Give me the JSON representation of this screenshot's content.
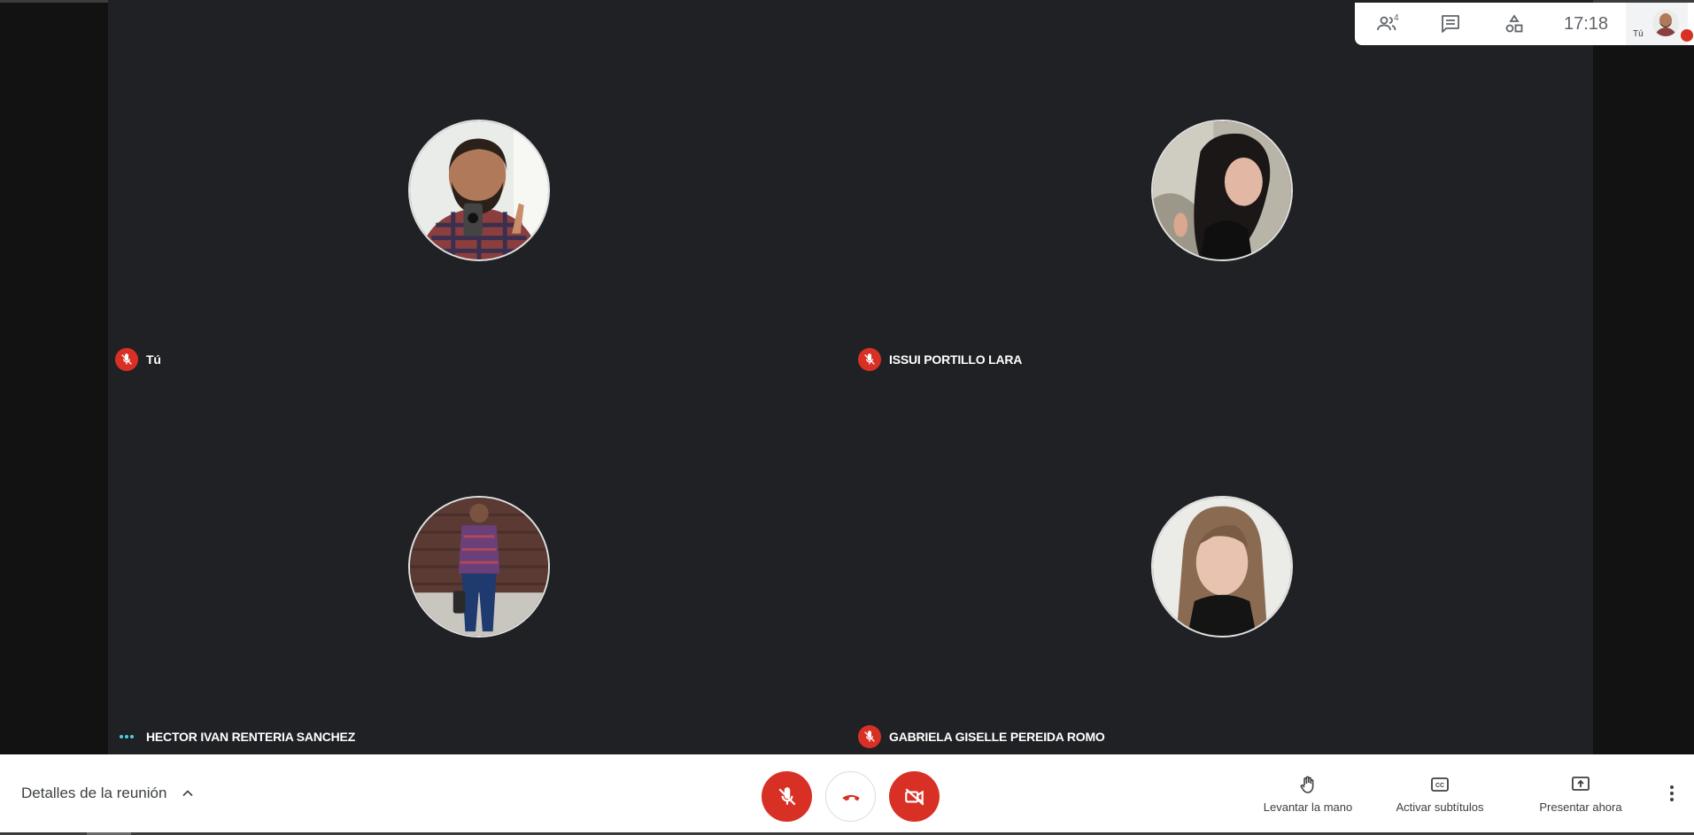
{
  "topbar": {
    "participants_count": "4",
    "clock": "17:18",
    "self_label": "Tú",
    "icons": [
      "people-icon",
      "chat-icon",
      "activities-icon"
    ]
  },
  "participants": [
    {
      "name": "Tú",
      "mic": "muted"
    },
    {
      "name": "ISSUI PORTILLO LARA",
      "mic": "muted"
    },
    {
      "name": "HECTOR IVAN RENTERIA SANCHEZ",
      "mic": "speaking"
    },
    {
      "name": "GABRIELA GISELLE PEREIDA ROMO",
      "mic": "muted"
    }
  ],
  "bottombar": {
    "details_label": "Detalles de la reunión",
    "raise_hand_label": "Levantar la mano",
    "captions_label": "Activar subtítulos",
    "present_label": "Presentar ahora"
  },
  "colors": {
    "stage": "#202124",
    "danger": "#d93025",
    "speaking": "#4ecde6"
  }
}
